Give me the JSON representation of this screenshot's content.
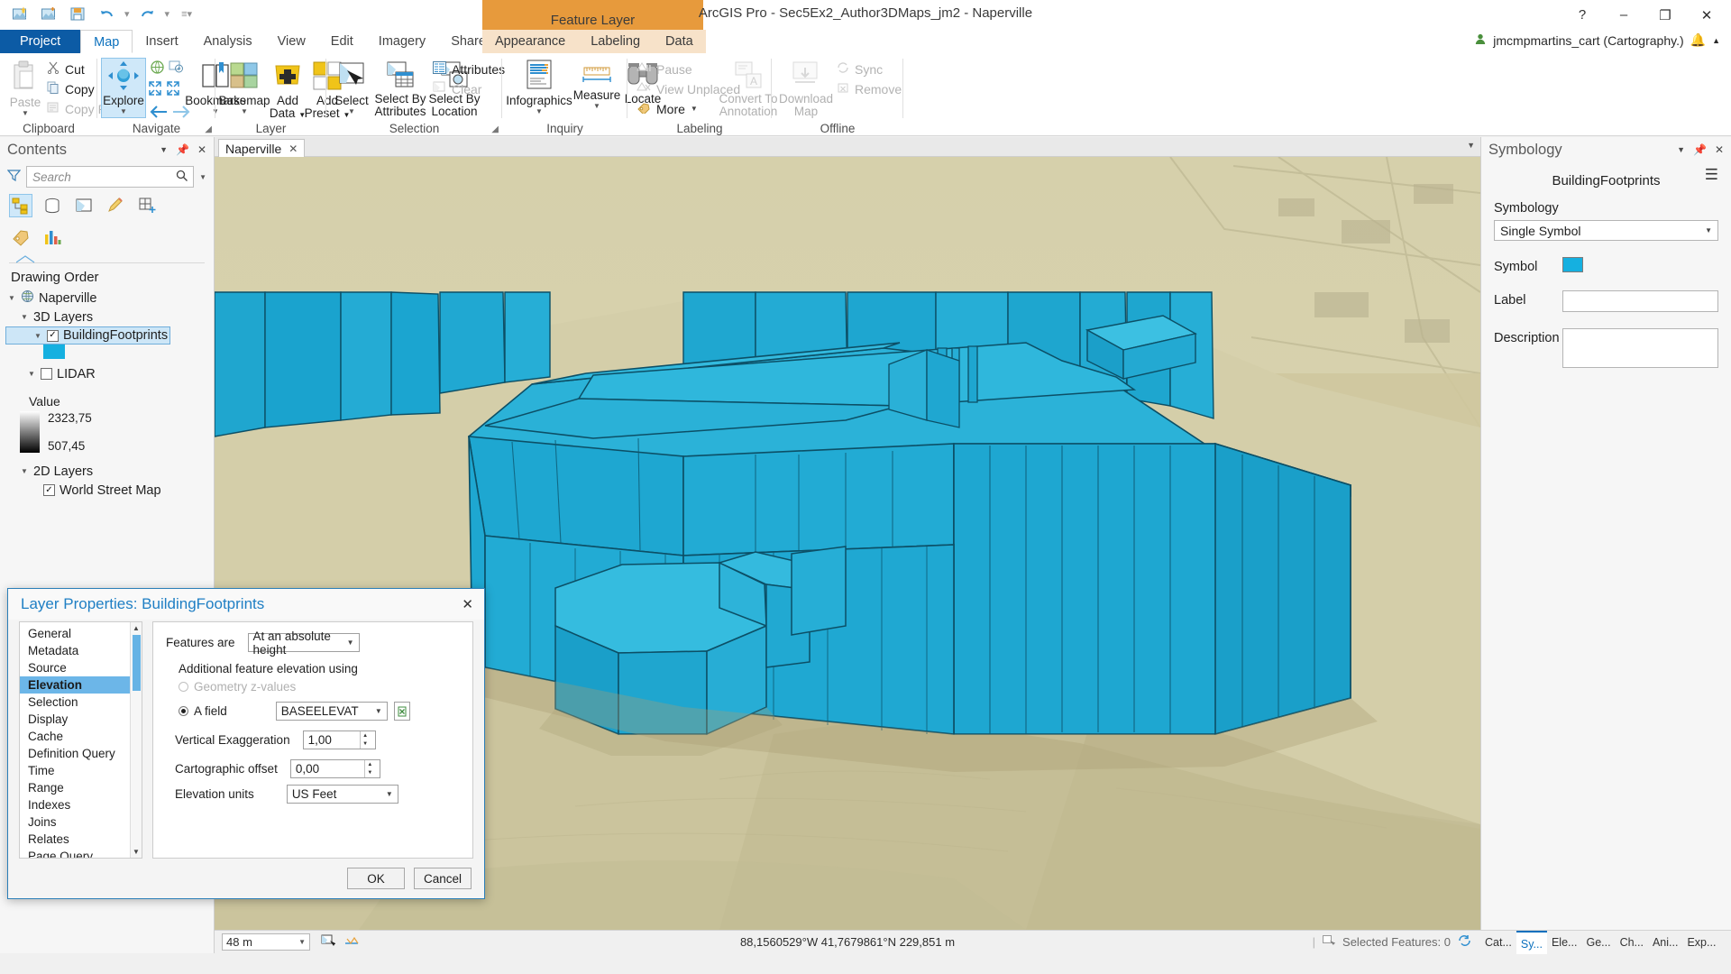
{
  "titlebar": {
    "app_title": "ArcGIS Pro - Sec5Ex2_Author3DMaps_jm2 - Naperville",
    "contextual_tab_group": "Feature Layer",
    "quick_access": [
      "new-project-icon",
      "open-project-icon",
      "save-project-icon",
      "undo-icon",
      "redo-icon",
      "customize-qat-icon"
    ],
    "window_buttons": {
      "help": "?",
      "minimize": "–",
      "maximize": "❐",
      "close": "✕"
    }
  },
  "ribbon": {
    "tabs": [
      "Project",
      "Map",
      "Insert",
      "Analysis",
      "View",
      "Edit",
      "Imagery",
      "Share"
    ],
    "contextual_tabs": [
      "Appearance",
      "Labeling",
      "Data"
    ],
    "active_tab": "Map",
    "user_account": "jmcmpmartins_cart (Cartography.)",
    "groups": [
      {
        "title": "Clipboard",
        "big": [
          {
            "label": "Paste",
            "icon": "paste-icon",
            "has_arrow": true,
            "disabled": true
          }
        ],
        "small": [
          {
            "label": "Cut",
            "icon": "cut-icon",
            "disabled": false
          },
          {
            "label": "Copy",
            "icon": "copy-icon",
            "disabled": false
          },
          {
            "label": "Copy Path",
            "icon": "copy-path-icon",
            "disabled": true
          }
        ]
      },
      {
        "title": "Navigate",
        "big": [
          {
            "label": "Explore",
            "icon": "explore-icon",
            "has_arrow": true,
            "selected": true
          },
          {
            "label": "Bookmarks",
            "icon": "bookmarks-icon",
            "has_arrow": true
          }
        ],
        "small": [
          {
            "label": "",
            "icon": "full-extent-icon"
          },
          {
            "label": "",
            "icon": "fixed-zoom-in-icon"
          },
          {
            "label": "",
            "icon": "previous-extent-icon"
          },
          {
            "label": "",
            "icon": "next-extent-icon"
          }
        ],
        "has_dialog_launcher": true
      },
      {
        "title": "Layer",
        "big": [
          {
            "label": "Basemap",
            "icon": "basemap-icon",
            "has_arrow": true
          },
          {
            "label": "Add\nData",
            "icon": "add-data-icon",
            "has_arrow": true
          },
          {
            "label": "Add\nPreset",
            "icon": "add-preset-icon",
            "has_arrow": true
          }
        ]
      },
      {
        "title": "Selection",
        "big": [
          {
            "label": "Select",
            "icon": "select-icon",
            "has_arrow": true
          },
          {
            "label": "Select By\nAttributes",
            "icon": "select-by-attributes-icon"
          },
          {
            "label": "Select By\nLocation",
            "icon": "select-by-location-icon"
          }
        ],
        "small": [
          {
            "label": "Attributes",
            "icon": "attributes-icon",
            "disabled": false
          },
          {
            "label": "Clear",
            "icon": "clear-icon",
            "disabled": true
          }
        ],
        "has_dialog_launcher": true
      },
      {
        "title": "Inquiry",
        "big": [
          {
            "label": "Infographics",
            "icon": "infographics-icon",
            "has_arrow": true
          },
          {
            "label": "Measure",
            "icon": "measure-icon",
            "has_arrow": true
          },
          {
            "label": "Locate",
            "icon": "locate-icon"
          }
        ]
      },
      {
        "title": "Labeling",
        "small": [
          {
            "label": "Pause",
            "icon": "pause-labeling-icon",
            "disabled": true
          },
          {
            "label": "View Unplaced",
            "icon": "view-unplaced-icon",
            "disabled": true
          },
          {
            "label": "More",
            "icon": "more-labeling-icon",
            "disabled": false,
            "has_arrow": true
          }
        ],
        "big": [
          {
            "label": "Convert To\nAnnotation",
            "icon": "convert-to-annotation-icon",
            "disabled": true
          }
        ]
      },
      {
        "title": "Offline",
        "big": [
          {
            "label": "Download\nMap",
            "icon": "download-map-icon",
            "disabled": true
          }
        ],
        "small": [
          {
            "label": "Sync",
            "icon": "sync-icon",
            "disabled": true
          },
          {
            "label": "Remove",
            "icon": "remove-offline-icon",
            "disabled": true
          }
        ]
      }
    ]
  },
  "contents": {
    "title": "Contents",
    "search_placeholder": "Search",
    "toolbar_icons": [
      "list-by-drawing-order-icon",
      "list-by-data-source-icon",
      "list-by-selection-icon",
      "list-by-editing-icon",
      "list-by-snapping-icon",
      "list-by-labeling-icon",
      "list-by-charts-icon"
    ],
    "drawing_order_label": "Drawing Order",
    "tree": [
      {
        "label": "Naperville",
        "type": "map",
        "indent": 0,
        "expanded": true
      },
      {
        "label": "3D Layers",
        "type": "group",
        "indent": 1,
        "expanded": true
      },
      {
        "label": "BuildingFootprints",
        "type": "layer",
        "indent": 2,
        "checked": true,
        "selected": true,
        "expanded": true
      },
      {
        "label": "LIDAR",
        "type": "layer",
        "indent": 2,
        "checked": false,
        "expanded": true
      },
      {
        "label": "2D Layers",
        "type": "group",
        "indent": 1,
        "expanded": true
      },
      {
        "label": "World Street Map",
        "type": "layer",
        "indent": 2,
        "checked": true
      }
    ],
    "symbol_color": "#15b0e0",
    "legend": {
      "title": "Value",
      "max": "2323,75",
      "min": "507,45"
    }
  },
  "map_view": {
    "tab_label": "Naperville",
    "scale": "48 m",
    "coordinates": "88,1560529°W 41,7679861°N  229,851 m",
    "selected_features": "Selected Features: 0"
  },
  "symbology": {
    "title": "Symbology",
    "layer_name": "BuildingFootprints",
    "section_label": "Symbology",
    "symbology_type": "Single Symbol",
    "symbol_label": "Symbol",
    "symbol_color": "#15b0e0",
    "label_field_label": "Label",
    "label_field_value": "",
    "description_label": "Description",
    "description_value": "",
    "menu_icon": "hamburger-menu-icon"
  },
  "dock_tabs": [
    {
      "label": "Cat...",
      "active": false
    },
    {
      "label": "Sy...",
      "active": true
    },
    {
      "label": "Ele...",
      "active": false
    },
    {
      "label": "Ge...",
      "active": false
    },
    {
      "label": "Ch...",
      "active": false
    },
    {
      "label": "Ani...",
      "active": false
    },
    {
      "label": "Exp...",
      "active": false
    }
  ],
  "dialog": {
    "title": "Layer Properties: BuildingFootprints",
    "close_label": "✕",
    "nav_items": [
      "General",
      "Metadata",
      "Source",
      "Elevation",
      "Selection",
      "Display",
      "Cache",
      "Definition Query",
      "Time",
      "Range",
      "Indexes",
      "Joins",
      "Relates",
      "Page Query"
    ],
    "active_nav": "Elevation",
    "features_are_label": "Features are",
    "features_are_value": "At an absolute height",
    "additional_elevation_label": "Additional feature elevation using",
    "geometry_z_label": "Geometry z-values",
    "geometry_z_selected": false,
    "geometry_z_disabled": true,
    "a_field_label": "A field",
    "a_field_selected": true,
    "a_field_value": "BASEELEVAT",
    "expression_button_icon": "expression-builder-icon",
    "vertical_exaggeration_label": "Vertical Exaggeration",
    "vertical_exaggeration_value": "1,00",
    "cartographic_offset_label": "Cartographic offset",
    "cartographic_offset_value": "0,00",
    "elevation_units_label": "Elevation units",
    "elevation_units_value": "US Feet",
    "ok_label": "OK",
    "cancel_label": "Cancel"
  }
}
